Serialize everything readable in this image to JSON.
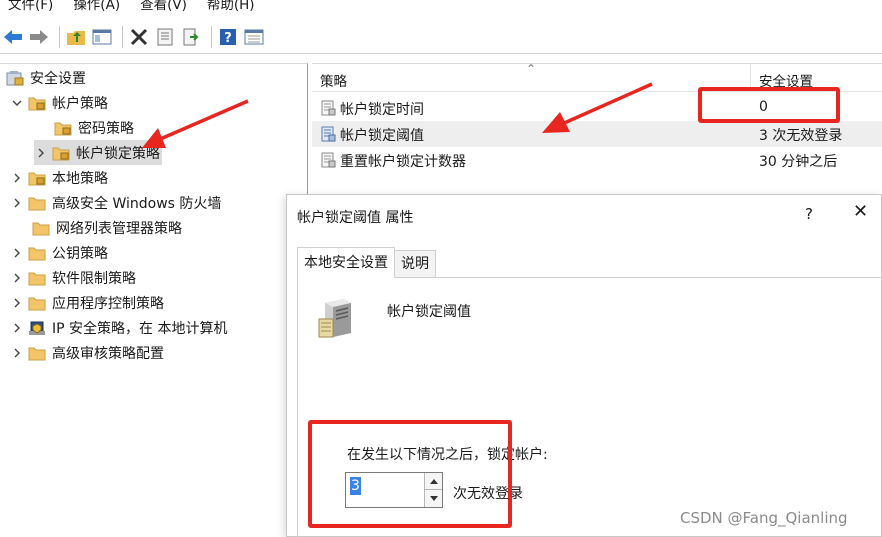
{
  "menu": {
    "items": [
      "文件(F)",
      "操作(A)",
      "查看(V)",
      "帮助(H)"
    ]
  },
  "toolbar": {
    "icons": [
      "back-icon",
      "forward-icon",
      "up-folder-icon",
      "show-hide-tree-icon",
      "delete-icon",
      "properties-icon",
      "export-icon",
      "help-icon",
      "view-icon"
    ]
  },
  "tree": {
    "items": [
      {
        "label": "安全设置",
        "level": 0
      },
      {
        "label": "帐户策略",
        "level": 1
      },
      {
        "label": "密码策略",
        "level": 2
      },
      {
        "label": "帐户锁定策略",
        "level": 2
      },
      {
        "label": "本地策略",
        "level": 1
      },
      {
        "label": "高级安全 Windows 防火墙",
        "level": 1
      },
      {
        "label": "网络列表管理器策略",
        "level": 1
      },
      {
        "label": "公钥策略",
        "level": 1
      },
      {
        "label": "软件限制策略",
        "level": 1
      },
      {
        "label": "应用程序控制策略",
        "level": 1
      },
      {
        "label": "IP 安全策略，在 本地计算机",
        "level": 1
      },
      {
        "label": "高级审核策略配置",
        "level": 1
      }
    ]
  },
  "list": {
    "columns": {
      "policy": "策略",
      "setting": "安全设置"
    },
    "rows": [
      {
        "name": "帐户锁定时间",
        "value": "0"
      },
      {
        "name": "帐户锁定阈值",
        "value": "3 次无效登录"
      },
      {
        "name": "重置帐户锁定计数器",
        "value": "30 分钟之后"
      }
    ]
  },
  "dialog": {
    "title": "帐户锁定阈值 属性",
    "help": "?",
    "close": "✕",
    "tabs": [
      "本地安全设置",
      "说明"
    ],
    "policy_name": "帐户锁定阈值",
    "caption": "在发生以下情况之后，锁定帐户:",
    "spin_value": "3",
    "suffix": "次无效登录"
  },
  "watermark": "CSDN @Fang_Qianling",
  "colors": {
    "annotation": "#e8261f",
    "folder": "#f2c668",
    "selection": "#dcdcdc",
    "spin_highlight": "#3c82e6"
  }
}
